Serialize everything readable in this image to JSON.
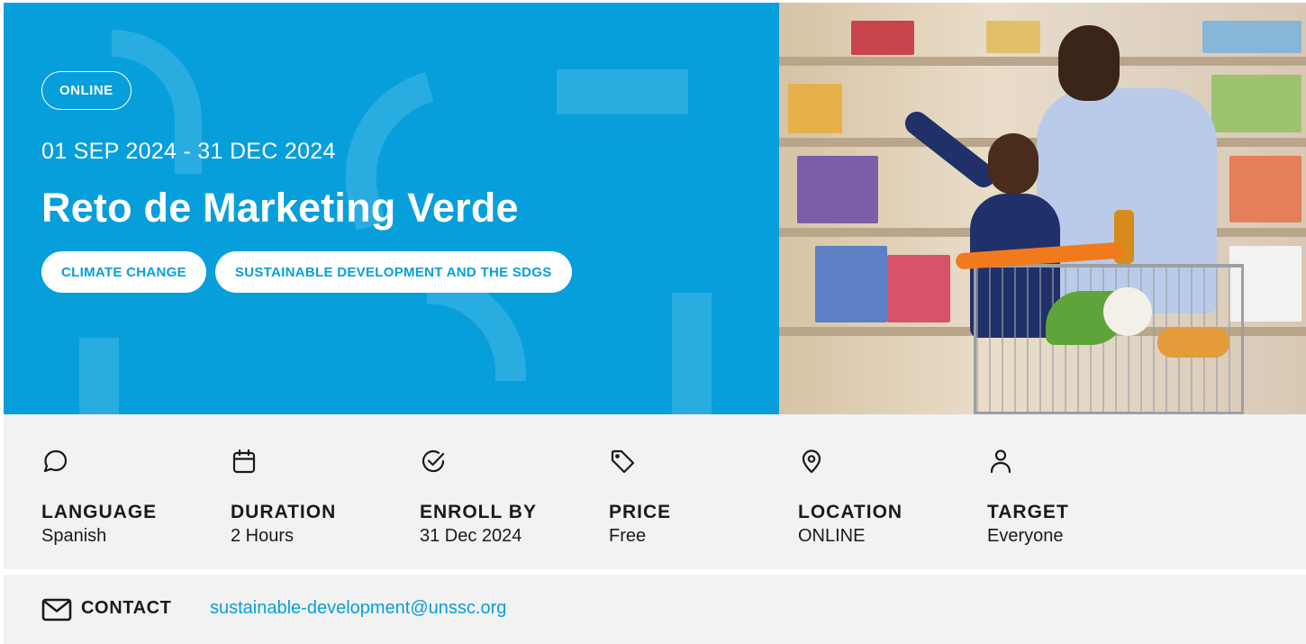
{
  "hero": {
    "mode_badge": "ONLINE",
    "dates": "01 SEP 2024 - 31 DEC 2024",
    "title": "Reto de Marketing Verde",
    "tags": [
      "CLIMATE CHANGE",
      "SUSTAINABLE DEVELOPMENT AND THE SDGS"
    ],
    "background_color": "#069fdb"
  },
  "info": {
    "items": [
      {
        "icon": "speech-bubble-icon",
        "label": "LANGUAGE",
        "value": "Spanish"
      },
      {
        "icon": "calendar-icon",
        "label": "DURATION",
        "value": "2 Hours"
      },
      {
        "icon": "check-circle-icon",
        "label": "ENROLL BY",
        "value": "31 Dec 2024"
      },
      {
        "icon": "price-tag-icon",
        "label": "PRICE",
        "value": "Free"
      },
      {
        "icon": "location-pin-icon",
        "label": "LOCATION",
        "value": "ONLINE"
      },
      {
        "icon": "person-icon",
        "label": "TARGET",
        "value": "Everyone"
      }
    ]
  },
  "contact": {
    "icon": "envelope-icon",
    "label": "CONTACT",
    "email": "sustainable-development@unssc.org",
    "link_color": "#069fdb"
  }
}
